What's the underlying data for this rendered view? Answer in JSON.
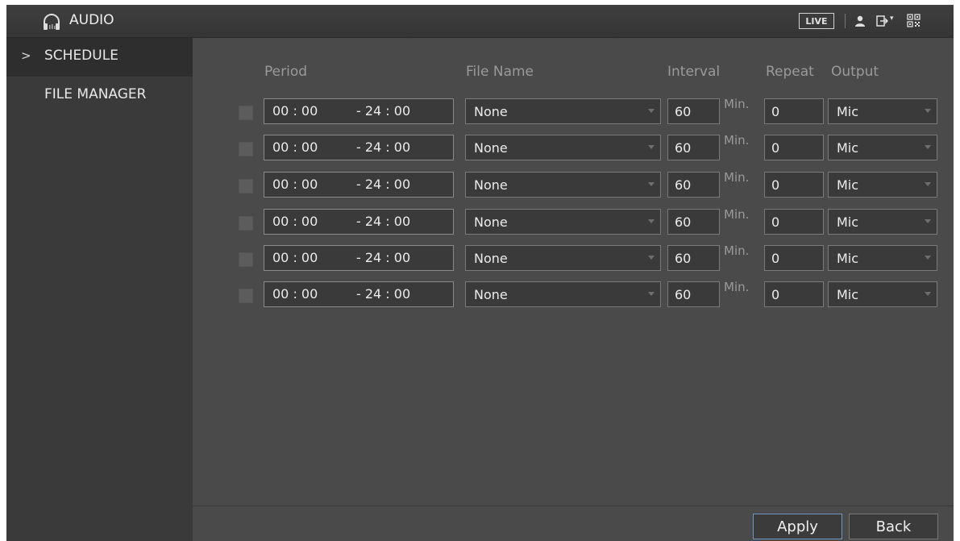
{
  "header": {
    "title": "AUDIO",
    "live_label": "LIVE",
    "icons": [
      "headphones-icon",
      "user-icon",
      "logout-icon",
      "qr-code-icon"
    ]
  },
  "sidebar": {
    "items": [
      {
        "label": "SCHEDULE",
        "active": true
      },
      {
        "label": "FILE MANAGER",
        "active": false
      }
    ]
  },
  "table": {
    "columns": {
      "period": "Period",
      "file_name": "File Name",
      "interval": "Interval",
      "repeat": "Repeat",
      "output": "Output"
    },
    "interval_unit": "Min.",
    "rows": [
      {
        "enabled": false,
        "start": "00 : 00",
        "end": "- 24 : 00",
        "file": "None",
        "interval": "60",
        "repeat": "0",
        "output": "Mic"
      },
      {
        "enabled": false,
        "start": "00 : 00",
        "end": "- 24 : 00",
        "file": "None",
        "interval": "60",
        "repeat": "0",
        "output": "Mic"
      },
      {
        "enabled": false,
        "start": "00 : 00",
        "end": "- 24 : 00",
        "file": "None",
        "interval": "60",
        "repeat": "0",
        "output": "Mic"
      },
      {
        "enabled": false,
        "start": "00 : 00",
        "end": "- 24 : 00",
        "file": "None",
        "interval": "60",
        "repeat": "0",
        "output": "Mic"
      },
      {
        "enabled": false,
        "start": "00 : 00",
        "end": "- 24 : 00",
        "file": "None",
        "interval": "60",
        "repeat": "0",
        "output": "Mic"
      },
      {
        "enabled": false,
        "start": "00 : 00",
        "end": "- 24 : 00",
        "file": "None",
        "interval": "60",
        "repeat": "0",
        "output": "Mic"
      }
    ]
  },
  "footer": {
    "apply_label": "Apply",
    "back_label": "Back"
  },
  "colors": {
    "background": "#4a4a4a",
    "sidebar": "#3a3a3a",
    "accent_border": "#6e97c4"
  }
}
